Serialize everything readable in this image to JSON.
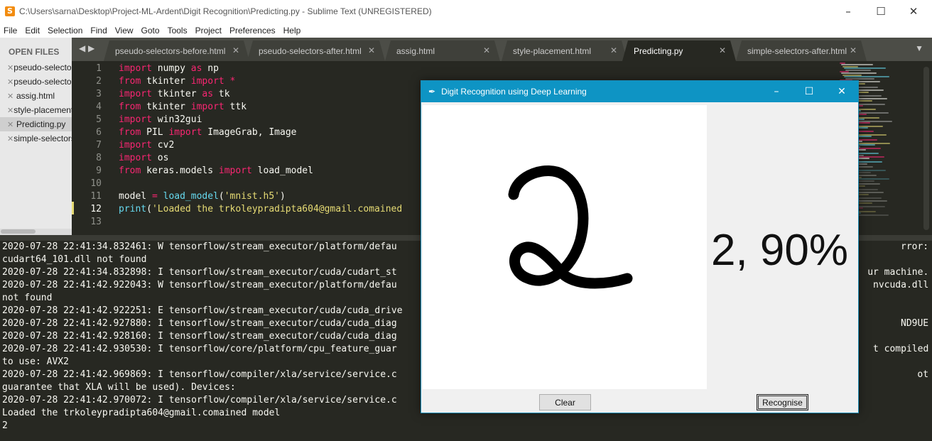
{
  "window": {
    "title": "C:\\Users\\sarna\\Desktop\\Project-ML-Ardent\\Digit Recognition\\Predicting.py - Sublime Text (UNREGISTERED)"
  },
  "menu": [
    "File",
    "Edit",
    "Selection",
    "Find",
    "View",
    "Goto",
    "Tools",
    "Project",
    "Preferences",
    "Help"
  ],
  "sidebar": {
    "header": "OPEN FILES",
    "files": [
      {
        "name": "pseudo-selectors-before.html"
      },
      {
        "name": "pseudo-selectors-after.html"
      },
      {
        "name": "assig.html"
      },
      {
        "name": "style-placement.html"
      },
      {
        "name": "Predicting.py"
      },
      {
        "name": "simple-selectors-after.html"
      }
    ]
  },
  "tabs": [
    {
      "label": "pseudo-selectors-before.html"
    },
    {
      "label": "pseudo-selectors-after.html"
    },
    {
      "label": "assig.html"
    },
    {
      "label": "style-placement.html"
    },
    {
      "label": "Predicting.py"
    },
    {
      "label": "simple-selectors-after.html"
    }
  ],
  "editor": {
    "line_numbers": [
      "1",
      "2",
      "3",
      "4",
      "5",
      "6",
      "7",
      "8",
      "9",
      "10",
      "11",
      "12",
      "13"
    ],
    "current_line": "12",
    "lines": [
      [
        {
          "t": "import",
          "c": "kw"
        },
        {
          "t": " numpy ",
          "c": ""
        },
        {
          "t": "as",
          "c": "kw"
        },
        {
          "t": " np",
          "c": ""
        }
      ],
      [
        {
          "t": "from",
          "c": "kw"
        },
        {
          "t": " tkinter ",
          "c": ""
        },
        {
          "t": "import",
          "c": "kw"
        },
        {
          "t": " *",
          "c": "kw"
        }
      ],
      [
        {
          "t": "import",
          "c": "kw"
        },
        {
          "t": " tkinter ",
          "c": ""
        },
        {
          "t": "as",
          "c": "kw"
        },
        {
          "t": " tk",
          "c": ""
        }
      ],
      [
        {
          "t": "from",
          "c": "kw"
        },
        {
          "t": " tkinter ",
          "c": ""
        },
        {
          "t": "import",
          "c": "kw"
        },
        {
          "t": " ttk",
          "c": ""
        }
      ],
      [
        {
          "t": "import",
          "c": "kw"
        },
        {
          "t": " win32gui",
          "c": ""
        }
      ],
      [
        {
          "t": "from",
          "c": "kw"
        },
        {
          "t": " PIL ",
          "c": ""
        },
        {
          "t": "import",
          "c": "kw"
        },
        {
          "t": " ImageGrab, Image",
          "c": ""
        }
      ],
      [
        {
          "t": "import",
          "c": "kw"
        },
        {
          "t": " cv2",
          "c": ""
        }
      ],
      [
        {
          "t": "import",
          "c": "kw"
        },
        {
          "t": " os",
          "c": ""
        }
      ],
      [
        {
          "t": "from",
          "c": "kw"
        },
        {
          "t": " keras.models ",
          "c": ""
        },
        {
          "t": "import",
          "c": "kw"
        },
        {
          "t": " load_model",
          "c": ""
        }
      ],
      [],
      [
        {
          "t": "model ",
          "c": ""
        },
        {
          "t": "=",
          "c": "kw"
        },
        {
          "t": " ",
          "c": ""
        },
        {
          "t": "load_model",
          "c": "fn"
        },
        {
          "t": "(",
          "c": ""
        },
        {
          "t": "'mnist.h5'",
          "c": "st"
        },
        {
          "t": ")",
          "c": ""
        }
      ],
      [
        {
          "t": "print",
          "c": "fn"
        },
        {
          "t": "(",
          "c": ""
        },
        {
          "t": "'Loaded the trkoleypradipta604@gmail.comained",
          "c": "st"
        }
      ],
      []
    ]
  },
  "console": [
    "2020-07-28 22:41:34.832461: W tensorflow/stream_executor/platform/defau",
    "cudart64_101.dll not found",
    "2020-07-28 22:41:34.832898: I tensorflow/stream_executor/cuda/cudart_st",
    "2020-07-28 22:41:42.922043: W tensorflow/stream_executor/platform/defau",
    "not found",
    "2020-07-28 22:41:42.922251: E tensorflow/stream_executor/cuda/cuda_drive",
    "2020-07-28 22:41:42.927880: I tensorflow/stream_executor/cuda/cuda_diag",
    "2020-07-28 22:41:42.928160: I tensorflow/stream_executor/cuda/cuda_diag",
    "2020-07-28 22:41:42.930530: I tensorflow/core/platform/cpu_feature_guar",
    "to use: AVX2",
    "2020-07-28 22:41:42.969869: I tensorflow/compiler/xla/service/service.c",
    "guarantee that XLA will be used). Devices:",
    "2020-07-28 22:41:42.970072: I tensorflow/compiler/xla/service/service.c",
    "Loaded the trkoleypradipta604@gmail.comained model",
    "2"
  ],
  "console_right": [
    {
      "row": 0,
      "text": "rror:"
    },
    {
      "row": 2,
      "text": "ur machine."
    },
    {
      "row": 3,
      "text": "nvcuda.dll"
    },
    {
      "row": 6,
      "text": "ND9UE"
    },
    {
      "row": 8,
      "text": "t compiled"
    },
    {
      "row": 10,
      "text": "ot"
    }
  ],
  "dialog": {
    "title": "Digit Recognition using Deep Learning",
    "prediction": "2, 90%",
    "clear_label": "Clear",
    "recognise_label": "Recognise"
  },
  "colors": {
    "editor_bg": "#272822",
    "keyword": "#f92672",
    "function": "#66d9ef",
    "string": "#e6db74",
    "dialog_title": "#0e94c4"
  }
}
